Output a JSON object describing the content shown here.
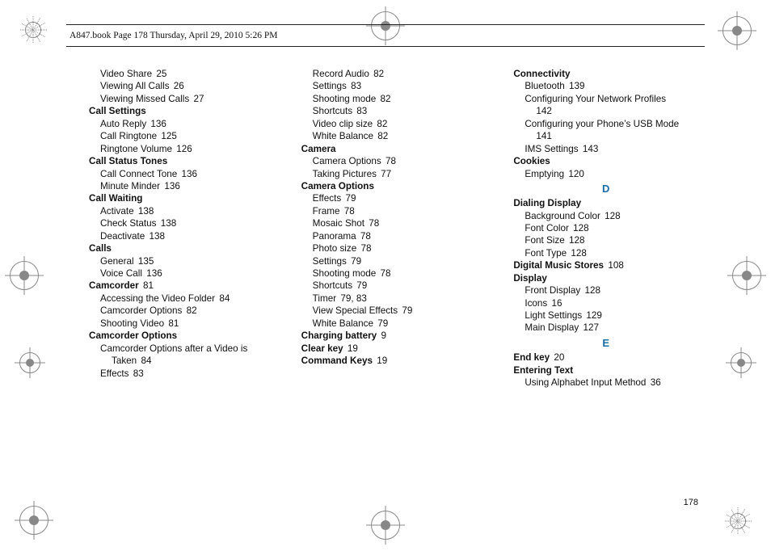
{
  "header": {
    "text": "A847.book  Page 178  Thursday, April 29, 2010  5:26 PM"
  },
  "page_number": "178",
  "letters": {
    "D": "D",
    "E": "E"
  },
  "col1": [
    {
      "t": "sub",
      "label": "Video Share",
      "pg": "25"
    },
    {
      "t": "sub",
      "label": "Viewing All Calls",
      "pg": "26"
    },
    {
      "t": "sub",
      "label": "Viewing Missed Calls",
      "pg": "27"
    },
    {
      "t": "head",
      "label": "Call Settings"
    },
    {
      "t": "sub",
      "label": "Auto Reply",
      "pg": "136"
    },
    {
      "t": "sub",
      "label": "Call Ringtone",
      "pg": "125"
    },
    {
      "t": "sub",
      "label": "Ringtone Volume",
      "pg": "126"
    },
    {
      "t": "head",
      "label": "Call Status Tones"
    },
    {
      "t": "sub",
      "label": "Call Connect Tone",
      "pg": "136"
    },
    {
      "t": "sub",
      "label": "Minute Minder",
      "pg": "136"
    },
    {
      "t": "head",
      "label": "Call Waiting"
    },
    {
      "t": "sub",
      "label": "Activate",
      "pg": "138"
    },
    {
      "t": "sub",
      "label": "Check Status",
      "pg": "138"
    },
    {
      "t": "sub",
      "label": "Deactivate",
      "pg": "138"
    },
    {
      "t": "head",
      "label": "Calls"
    },
    {
      "t": "sub",
      "label": "General",
      "pg": "135"
    },
    {
      "t": "sub",
      "label": "Voice Call",
      "pg": "136"
    },
    {
      "t": "headpg",
      "label": "Camcorder",
      "pg": "81"
    },
    {
      "t": "sub",
      "label": "Accessing the Video Folder",
      "pg": "84"
    },
    {
      "t": "sub",
      "label": "Camcorder Options",
      "pg": "82"
    },
    {
      "t": "sub",
      "label": "Shooting Video",
      "pg": "81"
    },
    {
      "t": "head",
      "label": "Camcorder Options"
    },
    {
      "t": "sub2a",
      "label": "Camcorder Options after a Video is"
    },
    {
      "t": "sub2b",
      "label": "Taken",
      "pg": "84"
    },
    {
      "t": "sub",
      "label": "Effects",
      "pg": "83"
    }
  ],
  "col2": [
    {
      "t": "sub",
      "label": "Record Audio",
      "pg": "82"
    },
    {
      "t": "sub",
      "label": "Settings",
      "pg": "83"
    },
    {
      "t": "sub",
      "label": "Shooting mode",
      "pg": "82"
    },
    {
      "t": "sub",
      "label": "Shortcuts",
      "pg": "83"
    },
    {
      "t": "sub",
      "label": "Video clip size",
      "pg": "82"
    },
    {
      "t": "sub",
      "label": "White Balance",
      "pg": "82"
    },
    {
      "t": "head",
      "label": "Camera"
    },
    {
      "t": "sub",
      "label": "Camera Options",
      "pg": "78"
    },
    {
      "t": "sub",
      "label": "Taking Pictures",
      "pg": "77"
    },
    {
      "t": "head",
      "label": "Camera Options"
    },
    {
      "t": "sub",
      "label": "Effects",
      "pg": "79"
    },
    {
      "t": "sub",
      "label": "Frame",
      "pg": "78"
    },
    {
      "t": "sub",
      "label": "Mosaic Shot",
      "pg": "78"
    },
    {
      "t": "sub",
      "label": "Panorama",
      "pg": "78"
    },
    {
      "t": "sub",
      "label": "Photo size",
      "pg": "78"
    },
    {
      "t": "sub",
      "label": "Settings",
      "pg": "79"
    },
    {
      "t": "sub",
      "label": "Shooting mode",
      "pg": "78"
    },
    {
      "t": "sub",
      "label": "Shortcuts",
      "pg": "79"
    },
    {
      "t": "sub",
      "label": "Timer",
      "pg": "79, 83"
    },
    {
      "t": "sub",
      "label": "View Special Effects",
      "pg": "79"
    },
    {
      "t": "sub",
      "label": "White Balance",
      "pg": "79"
    },
    {
      "t": "headpg",
      "label": "Charging battery",
      "pg": "9"
    },
    {
      "t": "headpg",
      "label": "Clear key",
      "pg": "19"
    },
    {
      "t": "headpg",
      "label": "Command Keys",
      "pg": "19"
    }
  ],
  "col3": [
    {
      "t": "head",
      "label": "Connectivity"
    },
    {
      "t": "sub",
      "label": "Bluetooth",
      "pg": "139"
    },
    {
      "t": "sub2a",
      "label": "Configuring Your Network Profiles"
    },
    {
      "t": "sub2c",
      "label": "142"
    },
    {
      "t": "sub2a",
      "label": "Configuring your Phone’s USB Mode"
    },
    {
      "t": "sub2c",
      "label": "141"
    },
    {
      "t": "sub",
      "label": "IMS Settings",
      "pg": "143"
    },
    {
      "t": "head",
      "label": "Cookies"
    },
    {
      "t": "sub",
      "label": "Emptying",
      "pg": "120"
    },
    {
      "t": "letter",
      "key": "D"
    },
    {
      "t": "head",
      "label": "Dialing Display"
    },
    {
      "t": "sub",
      "label": "Background Color",
      "pg": "128"
    },
    {
      "t": "sub",
      "label": "Font Color",
      "pg": "128"
    },
    {
      "t": "sub",
      "label": "Font Size",
      "pg": "128"
    },
    {
      "t": "sub",
      "label": "Font Type",
      "pg": "128"
    },
    {
      "t": "headpg",
      "label": "Digital Music Stores",
      "pg": "108"
    },
    {
      "t": "head",
      "label": "Display"
    },
    {
      "t": "sub",
      "label": "Front Display",
      "pg": "128"
    },
    {
      "t": "sub",
      "label": "Icons",
      "pg": "16"
    },
    {
      "t": "sub",
      "label": "Light Settings",
      "pg": "129"
    },
    {
      "t": "sub",
      "label": "Main Display",
      "pg": "127"
    },
    {
      "t": "letter",
      "key": "E"
    },
    {
      "t": "headpg",
      "label": "End key",
      "pg": "20"
    },
    {
      "t": "head",
      "label": "Entering Text"
    },
    {
      "t": "sub",
      "label": "Using Alphabet Input Method",
      "pg": "36"
    }
  ]
}
